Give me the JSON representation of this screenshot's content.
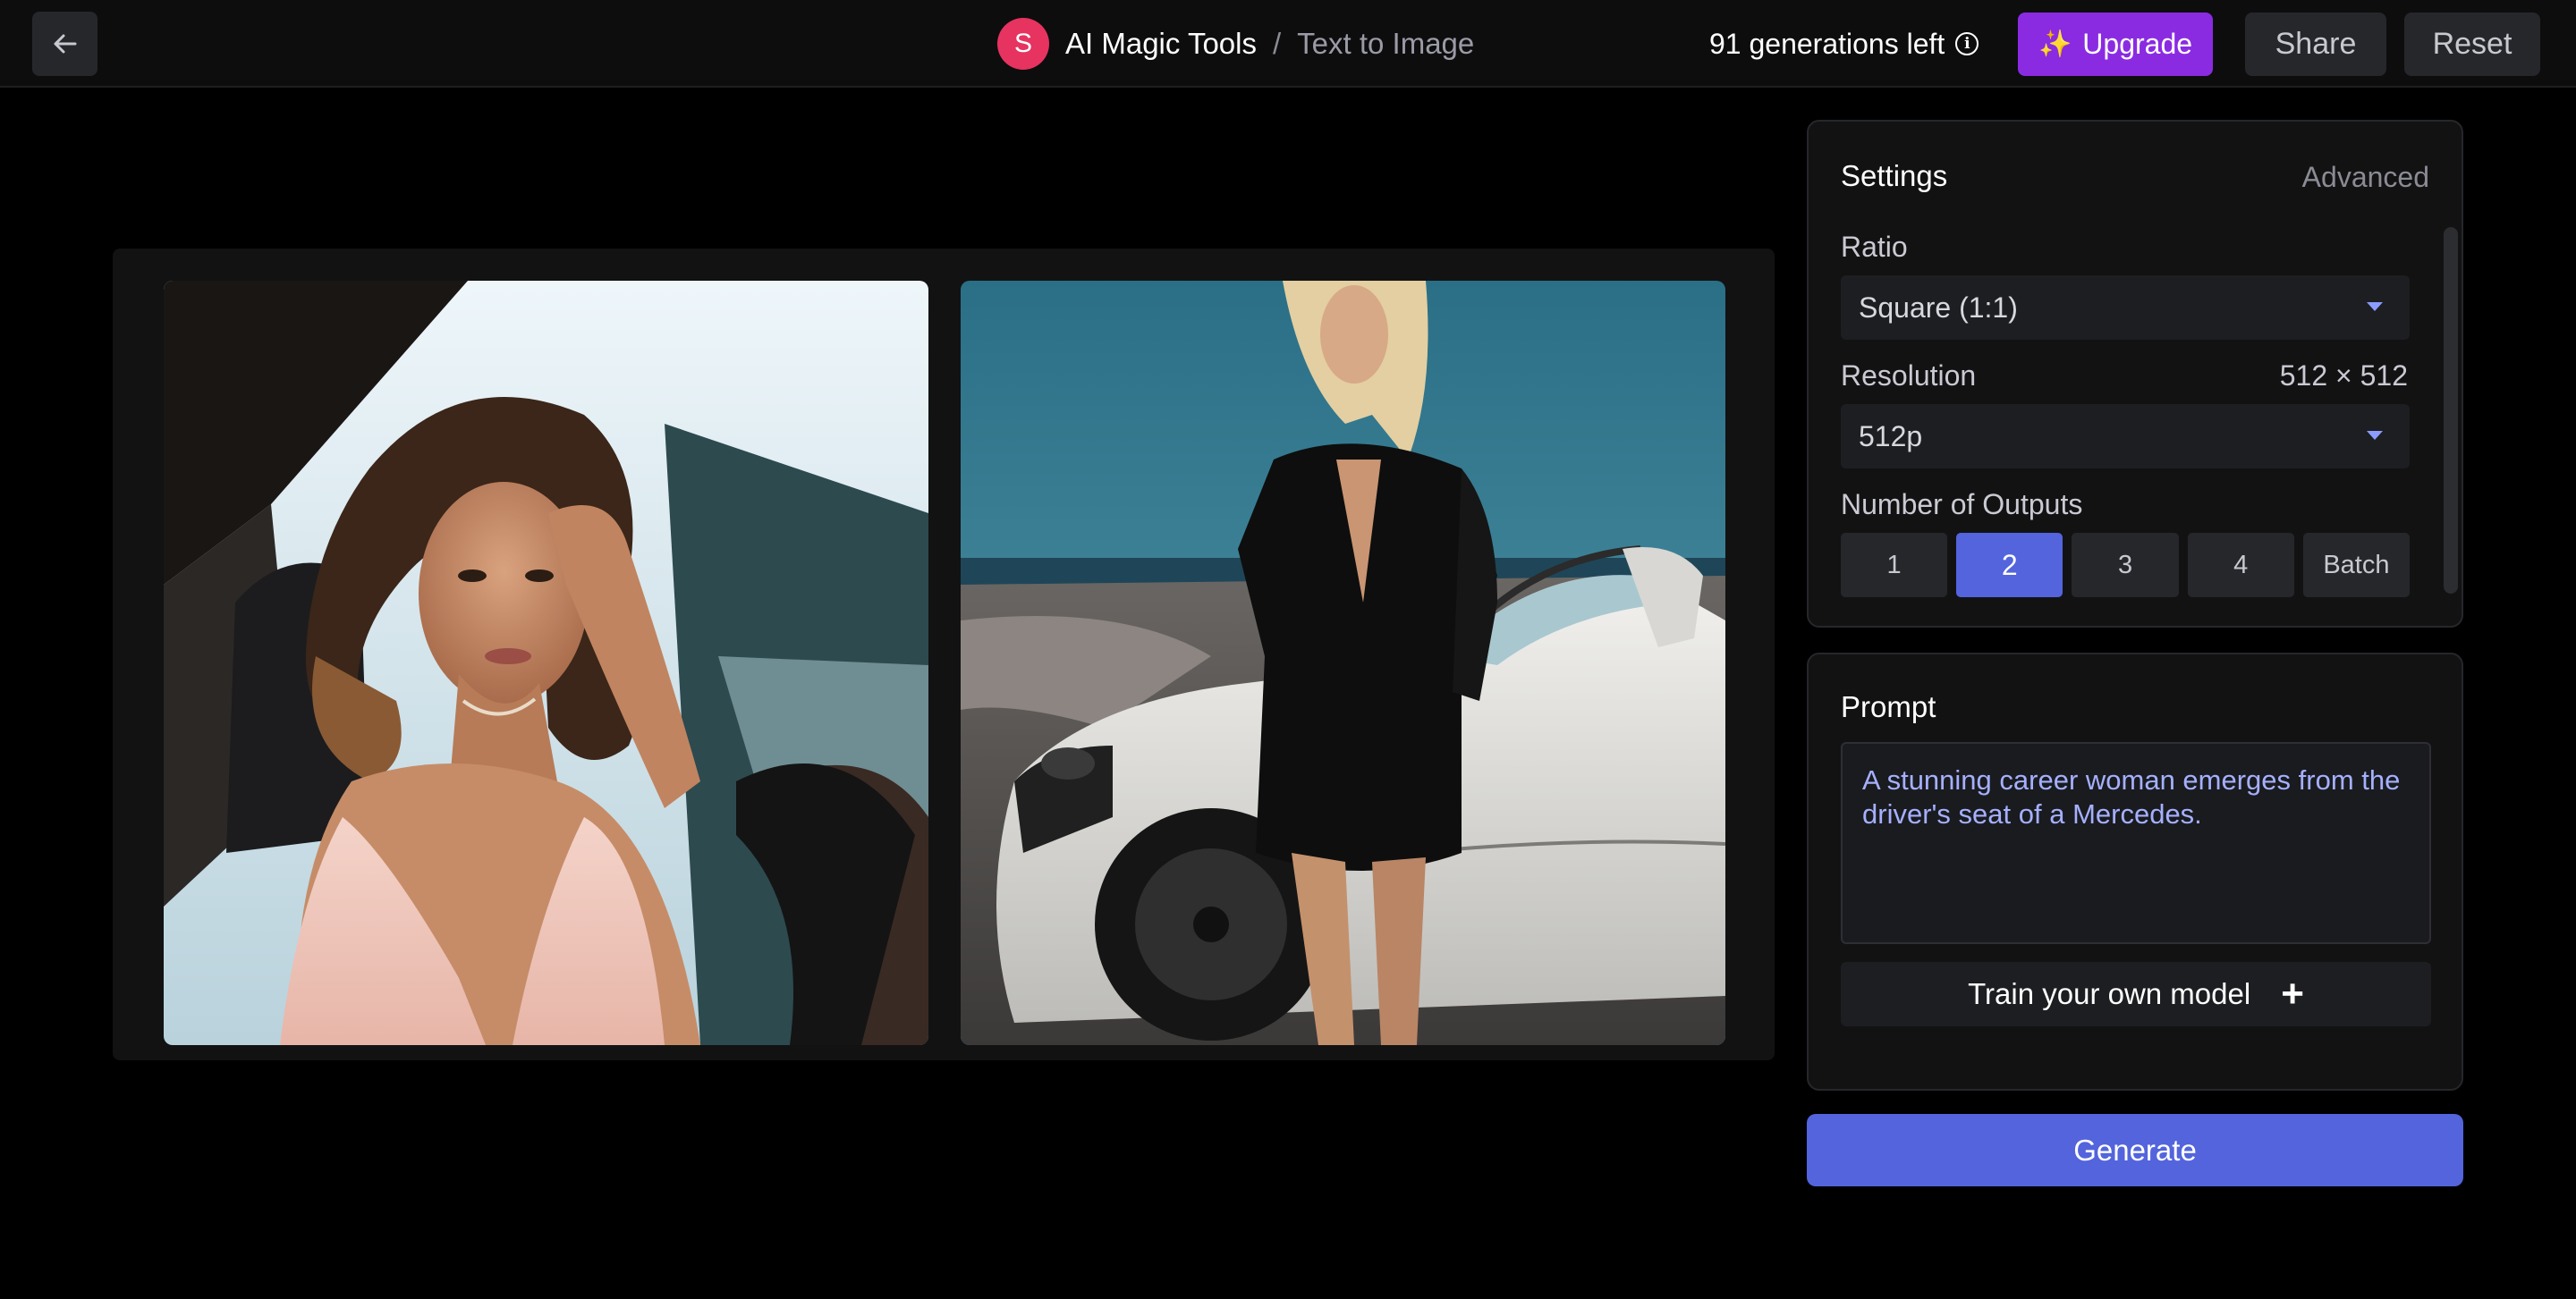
{
  "topbar": {
    "avatar_letter": "S",
    "app_name": "AI Magic Tools",
    "separator": "/",
    "page_name": "Text to Image",
    "generations_left": "91 generations left",
    "upgrade_label": "Upgrade",
    "share_label": "Share",
    "reset_label": "Reset"
  },
  "gallery": {
    "images": [
      {
        "subject": "woman-in-convertible"
      },
      {
        "subject": "woman-beside-white-mercedes"
      }
    ]
  },
  "settings": {
    "title": "Settings",
    "advanced_label": "Advanced",
    "ratio": {
      "label": "Ratio",
      "value": "Square (1:1)"
    },
    "resolution": {
      "label": "Resolution",
      "dimensions": "512 × 512",
      "value": "512p"
    },
    "outputs": {
      "label": "Number of Outputs",
      "options": [
        "1",
        "2",
        "3",
        "4",
        "Batch"
      ],
      "selected": "2"
    }
  },
  "prompt": {
    "title": "Prompt",
    "text": "A stunning career woman emerges from the driver's seat of a Mercedes.",
    "train_label": "Train your own model"
  },
  "generate_label": "Generate",
  "colors": {
    "accent": "#5364dd",
    "upgrade": "#8a2be2",
    "avatar": "#e6335f",
    "prompt_text": "#a5b0ff"
  }
}
